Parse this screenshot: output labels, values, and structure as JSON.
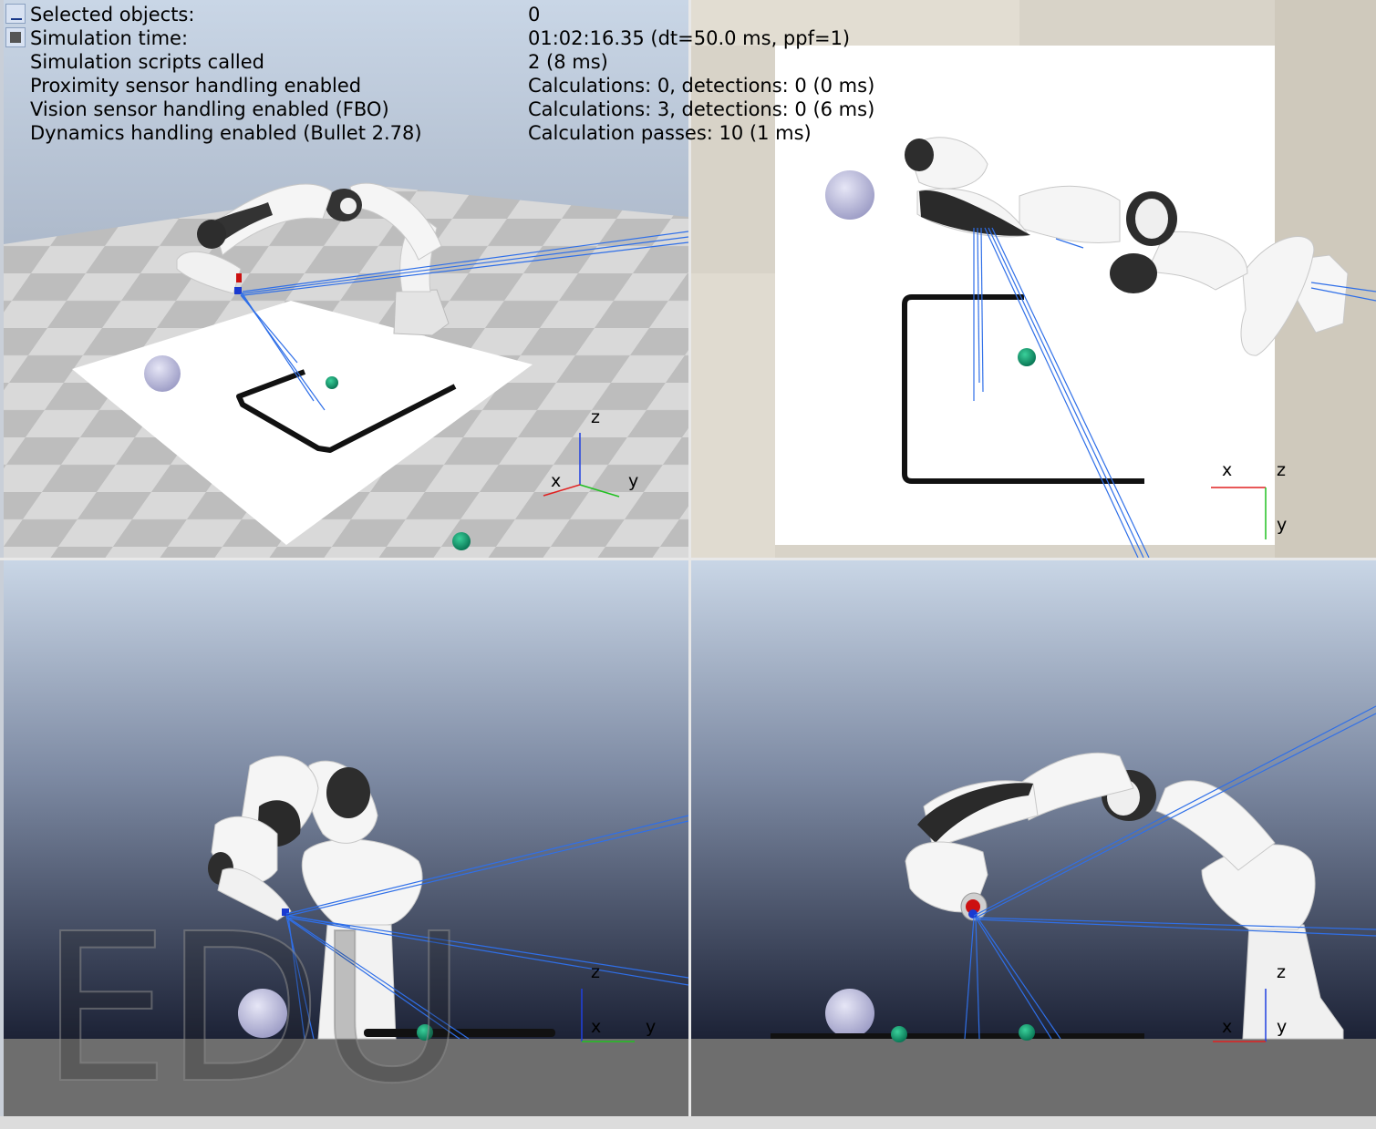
{
  "info": {
    "rows": [
      {
        "label": "Selected objects:",
        "value": "0"
      },
      {
        "label": "Simulation time:",
        "value": "01:02:16.35 (dt=50.0 ms, ppf=1)"
      },
      {
        "label": "Simulation scripts called",
        "value": "2 (8 ms)"
      },
      {
        "label": "Proximity sensor handling enabled",
        "value": "Calculations: 0, detections: 0 (0 ms)"
      },
      {
        "label": "Vision sensor handling enabled (FBO)",
        "value": "Calculations: 3, detections: 0 (6 ms)"
      },
      {
        "label": "Dynamics handling enabled (Bullet 2.78)",
        "value": "Calculation passes: 10 (1 ms)"
      }
    ],
    "buttons": [
      {
        "icon": "minimize-icon"
      },
      {
        "icon": "record-icon"
      }
    ]
  },
  "viewports": {
    "perspective": {
      "axis_x": "x",
      "axis_y": "y",
      "axis_z": "z"
    },
    "top": {
      "axis_x": "x",
      "axis_y": "y",
      "axis_z": "z"
    },
    "side": {
      "axis_x": "x",
      "axis_y": "y",
      "axis_z": "z"
    },
    "front": {
      "axis_x": "x",
      "axis_y": "y",
      "axis_z": "z"
    }
  },
  "watermark": "EDU",
  "colors": {
    "axis_x": "#e02020",
    "axis_y": "#20c020",
    "axis_z": "#2040e0",
    "sensor_ray": "#2f6fe8",
    "sphere": "#c8c8e8",
    "target": "#0a8a5a"
  }
}
